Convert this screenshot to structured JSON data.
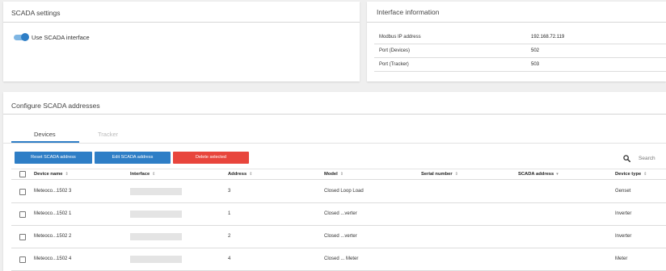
{
  "settings": {
    "title": "SCADA settings",
    "toggle_label": "Use SCADA interface",
    "toggle_on": true
  },
  "info": {
    "title": "Interface information",
    "rows": [
      {
        "key": "Modbus IP address",
        "value": "192.168.72.119"
      },
      {
        "key": "Port (Devices)",
        "value": "502"
      },
      {
        "key": "Port (Tracker)",
        "value": "503"
      }
    ]
  },
  "config": {
    "title": "Configure SCADA addresses",
    "tabs": [
      {
        "label": "Devices",
        "active": true
      },
      {
        "label": "Tracker",
        "active": false
      }
    ],
    "buttons": {
      "reset": "Reset SCADA address",
      "edit": "Edit SCADA address",
      "delete": "Delete selected"
    },
    "search_label": "Search",
    "columns": {
      "device_name": "Device name",
      "interface": "Interface",
      "address": "Address",
      "model": "Model",
      "serial_number": "Serial number",
      "scada_address": "SCADA address",
      "device_type": "Device type"
    },
    "sort_icons": {
      "unsorted": "⇕",
      "desc": "▾"
    },
    "rows": [
      {
        "device_name": "Meteoco...1502 3",
        "address": "3",
        "model": "Closed Loop Load",
        "serial_number": "",
        "scada_address": "",
        "device_type": "Genset"
      },
      {
        "device_name": "Meteoco...1502 1",
        "address": "1",
        "model": "Closed ...verter",
        "serial_number": "",
        "scada_address": "",
        "device_type": "Inverter"
      },
      {
        "device_name": "Meteoco...1502 2",
        "address": "2",
        "model": "Closed ...verter",
        "serial_number": "",
        "scada_address": "",
        "device_type": "Inverter"
      },
      {
        "device_name": "Meteoco...1502 4",
        "address": "4",
        "model": "Closed ... Meter",
        "serial_number": "",
        "scada_address": "",
        "device_type": "Meter"
      }
    ]
  },
  "colors": {
    "accent": "#2e7ec6",
    "danger": "#e8453c",
    "background": "#efefef"
  }
}
